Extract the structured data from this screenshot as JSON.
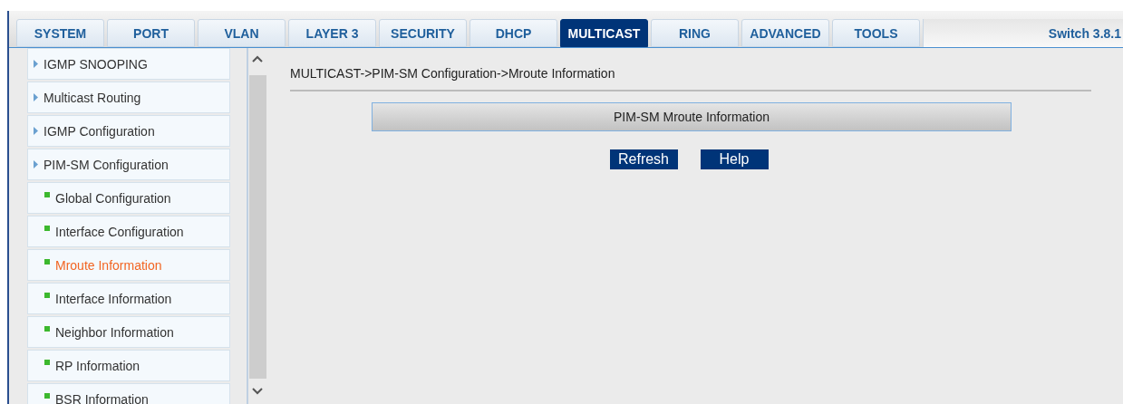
{
  "tabs": [
    {
      "label": "SYSTEM",
      "selected": false
    },
    {
      "label": "PORT",
      "selected": false
    },
    {
      "label": "VLAN",
      "selected": false
    },
    {
      "label": "LAYER 3",
      "selected": false
    },
    {
      "label": "SECURITY",
      "selected": false
    },
    {
      "label": "DHCP",
      "selected": false
    },
    {
      "label": "MULTICAST",
      "selected": true
    },
    {
      "label": "RING",
      "selected": false
    },
    {
      "label": "ADVANCED",
      "selected": false
    },
    {
      "label": "TOOLS",
      "selected": false
    }
  ],
  "version": "Switch 3.8.1",
  "sidebar": {
    "items": [
      {
        "kind": "group",
        "label": "IGMP SNOOPING",
        "selected": false
      },
      {
        "kind": "group",
        "label": "Multicast Routing",
        "selected": false
      },
      {
        "kind": "group",
        "label": "IGMP Configuration",
        "selected": false
      },
      {
        "kind": "group",
        "label": "PIM-SM Configuration",
        "selected": false
      },
      {
        "kind": "leaf",
        "label": "Global Configuration",
        "selected": false
      },
      {
        "kind": "leaf",
        "label": "Interface Configuration",
        "selected": false
      },
      {
        "kind": "leaf",
        "label": "Mroute Information",
        "selected": true
      },
      {
        "kind": "leaf",
        "label": "Interface Information",
        "selected": false
      },
      {
        "kind": "leaf",
        "label": "Neighbor Information",
        "selected": false
      },
      {
        "kind": "leaf",
        "label": "RP Information",
        "selected": false
      },
      {
        "kind": "leaf",
        "label": "BSR Information",
        "selected": false
      }
    ]
  },
  "breadcrumb": "MULTICAST->PIM-SM Configuration->Mroute Information",
  "panel": {
    "title": "PIM-SM Mroute Information"
  },
  "buttons": [
    "Refresh",
    "Help"
  ]
}
